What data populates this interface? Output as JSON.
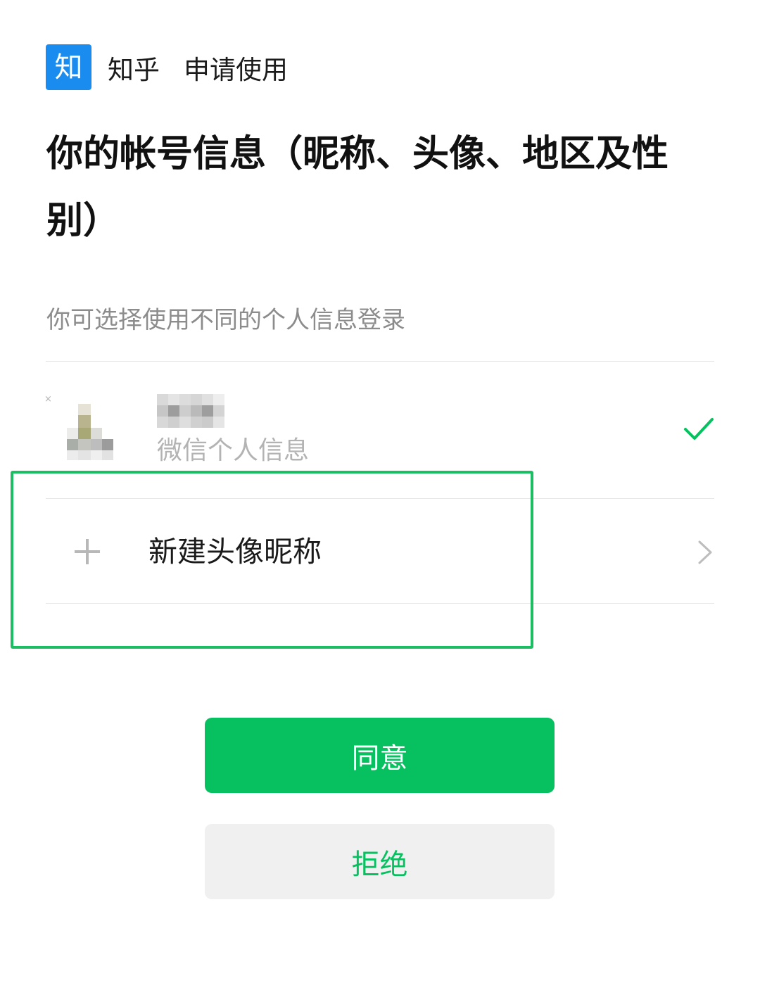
{
  "header": {
    "logo_char": "知",
    "app_name": "知乎",
    "request_text": "申请使用"
  },
  "title": "你的帐号信息（昵称、头像、地区及性别）",
  "subtitle": "你可选择使用不同的个人信息登录",
  "accounts": [
    {
      "label": "微信个人信息",
      "selected": true,
      "avatar_close_glyph": "×"
    }
  ],
  "new_profile": {
    "label": "新建头像昵称"
  },
  "buttons": {
    "agree_label": "同意",
    "reject_label": "拒绝"
  },
  "colors": {
    "brand_green": "#07c160",
    "logo_blue": "#1a8cf0",
    "highlight_border": "#1dbd63",
    "muted_text": "#8c8c8c"
  }
}
